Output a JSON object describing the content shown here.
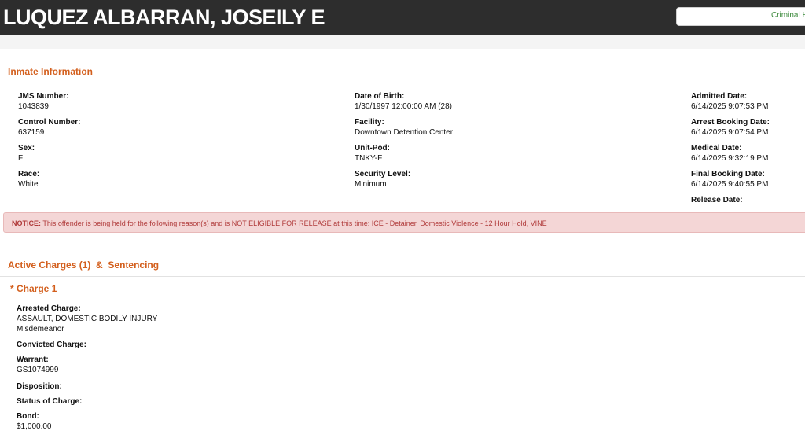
{
  "header": {
    "name": "LUQUEZ ALBARRAN, JOSEILY E",
    "button_label": "Criminal H"
  },
  "inmate_section": {
    "title": "Inmate Information",
    "col1": [
      {
        "label": "JMS Number:",
        "value": "1043839"
      },
      {
        "label": "Control Number:",
        "value": "637159"
      },
      {
        "label": "Sex:",
        "value": "F"
      },
      {
        "label": "Race:",
        "value": "White"
      }
    ],
    "col2": [
      {
        "label": "Date of Birth:",
        "value": "1/30/1997 12:00:00 AM (28)"
      },
      {
        "label": "Facility:",
        "value": "Downtown Detention Center"
      },
      {
        "label": "Unit-Pod:",
        "value": "TNKY-F"
      },
      {
        "label": "Security Level:",
        "value": "Minimum"
      }
    ],
    "col3": [
      {
        "label": "Admitted Date:",
        "value": "6/14/2025 9:07:53 PM"
      },
      {
        "label": "Arrest Booking Date:",
        "value": "6/14/2025 9:07:54 PM"
      },
      {
        "label": "Medical Date:",
        "value": "6/14/2025 9:32:19 PM"
      },
      {
        "label": "Final Booking Date:",
        "value": "6/14/2025 9:40:55 PM"
      },
      {
        "label": "Release Date:",
        "value": ""
      }
    ]
  },
  "notice": {
    "prefix": "NOTICE:",
    "text": " This offender is being held for the following reason(s) and is NOT ELIGIBLE FOR RELEASE at this time: ICE - Detainer, Domestic Violence - 12 Hour Hold, VINE"
  },
  "charges_section": {
    "title_part1": "Active Charges (1)",
    "title_amp": "&",
    "title_part2": "Sentencing",
    "charge_heading": "* Charge 1",
    "fields": {
      "arrested_label": "Arrested Charge:",
      "arrested_value": "ASSAULT, DOMESTIC BODILY INJURY",
      "arrested_class": "Misdemeanor",
      "convicted_label": "Convicted Charge:",
      "warrant_label": "Warrant:",
      "warrant_value": "GS1074999",
      "disposition_label": "Disposition:",
      "status_label": "Status of Charge:",
      "bond_label": "Bond:",
      "bond_value": "$1,000.00"
    }
  },
  "colors": {
    "header_bg": "#2d2d2d",
    "accent": "#d35f1d",
    "notice_bg": "#f4d6d6",
    "notice_text": "#b03a3a",
    "button_text": "#3c8a3c"
  }
}
